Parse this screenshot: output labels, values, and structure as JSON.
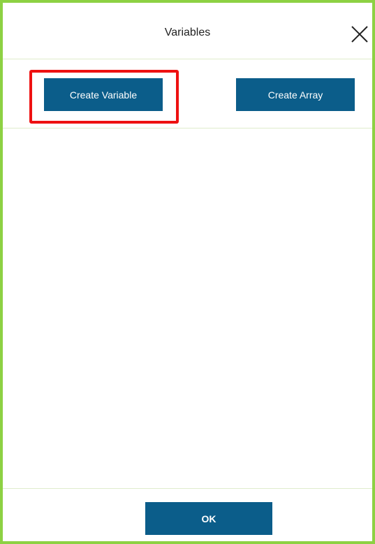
{
  "dialog": {
    "title": "Variables",
    "close_icon": "close-icon",
    "border_color": "#8dd143"
  },
  "actions": {
    "create_variable_label": "Create Variable",
    "create_array_label": "Create Array",
    "button_color": "#0b5d8a",
    "highlight_color": "#ee1111"
  },
  "footer": {
    "ok_label": "OK"
  }
}
